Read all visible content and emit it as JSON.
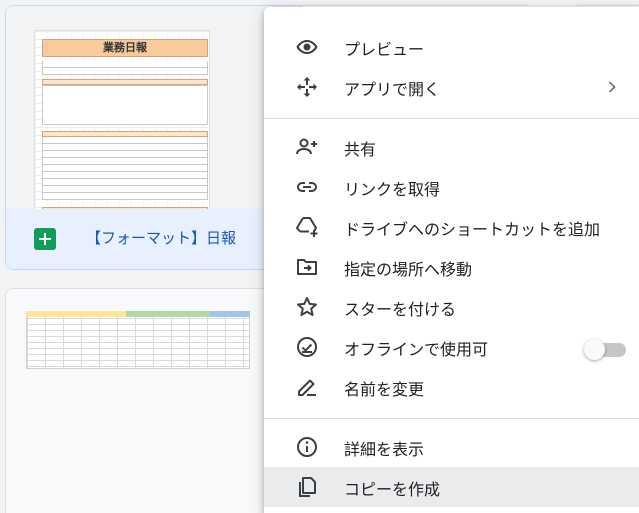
{
  "files": [
    {
      "title": "【フォーマット】日報",
      "type_icon": "google-sheets-icon",
      "thumbnail_heading": "業務日報"
    },
    {
      "type_icon": "google-sheets-icon"
    }
  ],
  "context_menu": {
    "items": [
      {
        "label": "プレビュー",
        "icon": "eye-icon"
      },
      {
        "label": "アプリで開く",
        "icon": "move-arrows-icon",
        "has_submenu": true
      },
      {
        "label": "共有",
        "icon": "person-add-icon"
      },
      {
        "label": "リンクを取得",
        "icon": "link-icon"
      },
      {
        "label": "ドライブへのショートカットを追加",
        "icon": "drive-shortcut-icon"
      },
      {
        "label": "指定の場所へ移動",
        "icon": "folder-move-icon"
      },
      {
        "label": "スターを付ける",
        "icon": "star-icon"
      },
      {
        "label": "オフラインで使用可",
        "icon": "offline-check-icon",
        "toggle_on": false
      },
      {
        "label": "名前を変更",
        "icon": "pencil-icon"
      },
      {
        "label": "詳細を表示",
        "icon": "info-icon"
      },
      {
        "label": "コピーを作成",
        "icon": "copy-icon",
        "highlighted": true
      }
    ]
  },
  "colors": {
    "selected_card": "#e8f0fe",
    "file_title_text": "#1a56b8",
    "sheets_green": "#0f9d58",
    "menu_hover": "#eaebec"
  }
}
